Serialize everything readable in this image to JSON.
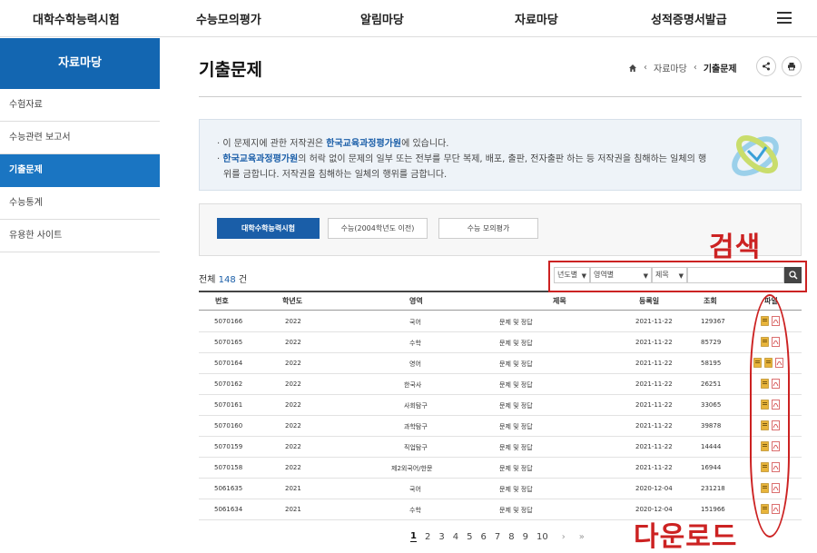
{
  "topnav": {
    "items": [
      "대학수학능력시험",
      "수능모의평가",
      "알림마당",
      "자료마당",
      "성적증명서발급"
    ]
  },
  "sidebar": {
    "title": "자료마당",
    "items": [
      "수험자료",
      "수능관련 보고서",
      "기출문제",
      "수능통계",
      "유용한 사이트"
    ],
    "active_index": 2
  },
  "page": {
    "title": "기출문제",
    "breadcrumb": [
      "자료마당",
      "기출문제"
    ]
  },
  "notice": {
    "line1_pre": "· 이 문제지에 관한 저작권은 ",
    "line1_org": "한국교육과정평가원",
    "line1_post": "에 있습니다.",
    "line2_org": "한국교육과정평가원",
    "line2_post": "의 허락 없이 문제의 일부 또는 전부를 무단 복제, 배포, 출판, 전자출판 하는 등 저작권을 침해하는 일체의 행",
    "line3": "위를 금합니다. 저작권을 침해하는 일체의 행위를 금합니다."
  },
  "tabs": [
    "대학수학능력시험",
    "수능(2004학년도 이전)",
    "수능 모의평가"
  ],
  "active_tab": 0,
  "count": {
    "prefix": "전체",
    "value": "148",
    "suffix": "건"
  },
  "search": {
    "year_select": "년도별",
    "area_select": "영역별",
    "field_select": "제목",
    "query": ""
  },
  "annotations": {
    "search": "검색",
    "download": "다운로드"
  },
  "table": {
    "columns": [
      "번호",
      "학년도",
      "영역",
      "제목",
      "등록일",
      "조회",
      "파일"
    ],
    "rows": [
      {
        "no": "5070166",
        "year": "2022",
        "area": "국어",
        "title": "문제 및 정답",
        "date": "2021-11-22",
        "views": "129367",
        "files": 2
      },
      {
        "no": "5070165",
        "year": "2022",
        "area": "수학",
        "title": "문제 및 정답",
        "date": "2021-11-22",
        "views": "85729",
        "files": 2
      },
      {
        "no": "5070164",
        "year": "2022",
        "area": "영어",
        "title": "문제 및 정답",
        "date": "2021-11-22",
        "views": "58195",
        "files": 3
      },
      {
        "no": "5070162",
        "year": "2022",
        "area": "한국사",
        "title": "문제 및 정답",
        "date": "2021-11-22",
        "views": "26251",
        "files": 2
      },
      {
        "no": "5070161",
        "year": "2022",
        "area": "사회탐구",
        "title": "문제 및 정답",
        "date": "2021-11-22",
        "views": "33065",
        "files": 2
      },
      {
        "no": "5070160",
        "year": "2022",
        "area": "과학탐구",
        "title": "문제 및 정답",
        "date": "2021-11-22",
        "views": "39878",
        "files": 2
      },
      {
        "no": "5070159",
        "year": "2022",
        "area": "직업탐구",
        "title": "문제 및 정답",
        "date": "2021-11-22",
        "views": "14444",
        "files": 2
      },
      {
        "no": "5070158",
        "year": "2022",
        "area": "제2외국어/한문",
        "title": "문제 및 정답",
        "date": "2021-11-22",
        "views": "16944",
        "files": 2
      },
      {
        "no": "5061635",
        "year": "2021",
        "area": "국어",
        "title": "문제 및 정답",
        "date": "2020-12-04",
        "views": "231218",
        "files": 2
      },
      {
        "no": "5061634",
        "year": "2021",
        "area": "수학",
        "title": "문제 및 정답",
        "date": "2020-12-04",
        "views": "151966",
        "files": 2
      }
    ]
  },
  "pagination": {
    "pages": [
      "1",
      "2",
      "3",
      "4",
      "5",
      "6",
      "7",
      "8",
      "9",
      "10"
    ],
    "current": "1",
    "next": "›",
    "last": "»"
  },
  "colors": {
    "brand": "#1366b1",
    "annotation": "#cc2222"
  }
}
